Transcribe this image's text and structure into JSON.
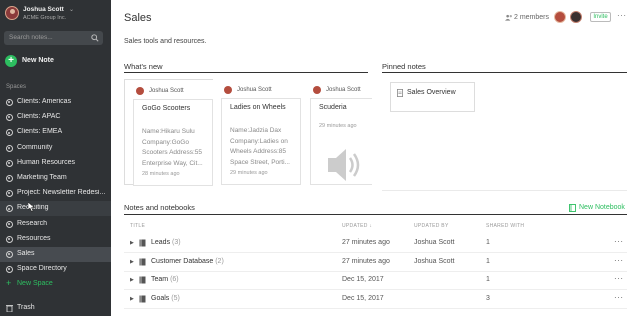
{
  "account": {
    "name": "Joshua Scott",
    "org": "ACME Group Inc."
  },
  "search": {
    "placeholder": "Search notes..."
  },
  "new_note_label": "New Note",
  "spaces_heading": "Spaces",
  "spaces": [
    {
      "label": "Clients: Americas"
    },
    {
      "label": "Clients: APAC"
    },
    {
      "label": "Clients: EMEA"
    },
    {
      "label": "Community"
    },
    {
      "label": "Human Resources"
    },
    {
      "label": "Marketing Team"
    },
    {
      "label": "Project: Newsletter Redesi..."
    },
    {
      "label": "Recruiting"
    },
    {
      "label": "Research"
    },
    {
      "label": "Resources"
    },
    {
      "label": "Sales"
    },
    {
      "label": "Space Directory"
    }
  ],
  "active_space": "Sales",
  "new_space_label": "New Space",
  "trash_label": "Trash",
  "page": {
    "title": "Sales",
    "members": "2 members",
    "invite": "Invite",
    "more": "···",
    "description": "Sales tools and resources."
  },
  "whats_new": {
    "heading": "What's new",
    "cards": [
      {
        "owner": "Joshua Scott",
        "title": "GoGo Scooters",
        "snippet": "Name:Hikaru Sulu Company:GoGo Scooters Address:55 Enterprise Way, Cit...",
        "time": "28 minutes ago"
      },
      {
        "owner": "Joshua Scott",
        "title": "Ladies on Wheels",
        "snippet": "Name:Jadzia Dax Company:Ladies on Wheels Address:85 Space Street, Porti...",
        "time": "29 minutes ago"
      },
      {
        "owner": "Joshua Scott",
        "title": "Scuderia",
        "time": "29 minutes ago"
      }
    ]
  },
  "pinned": {
    "heading": "Pinned notes",
    "items": [
      {
        "label": "Sales Overview"
      }
    ]
  },
  "notebooks": {
    "heading": "Notes and notebooks",
    "new_label": "New Notebook",
    "columns": {
      "title": "TITLE",
      "updated": "UPDATED",
      "updated_by": "UPDATED BY",
      "shared_with": "SHARED WITH"
    },
    "rows": [
      {
        "title": "Leads",
        "count": "(3)",
        "updated": "27 minutes ago",
        "by": "Joshua Scott",
        "shared": "1"
      },
      {
        "title": "Customer Database",
        "count": "(2)",
        "updated": "27 minutes ago",
        "by": "Joshua Scott",
        "shared": "1"
      },
      {
        "title": "Team",
        "count": "(6)",
        "updated": "Dec 15, 2017",
        "by": "",
        "shared": "1"
      },
      {
        "title": "Goals",
        "count": "(5)",
        "updated": "Dec 15, 2017",
        "by": "",
        "shared": "3"
      }
    ]
  },
  "colors": {
    "accent": "#2dbe60",
    "sidebar_bg": "#2f3235",
    "active_bg": "#474b50"
  }
}
